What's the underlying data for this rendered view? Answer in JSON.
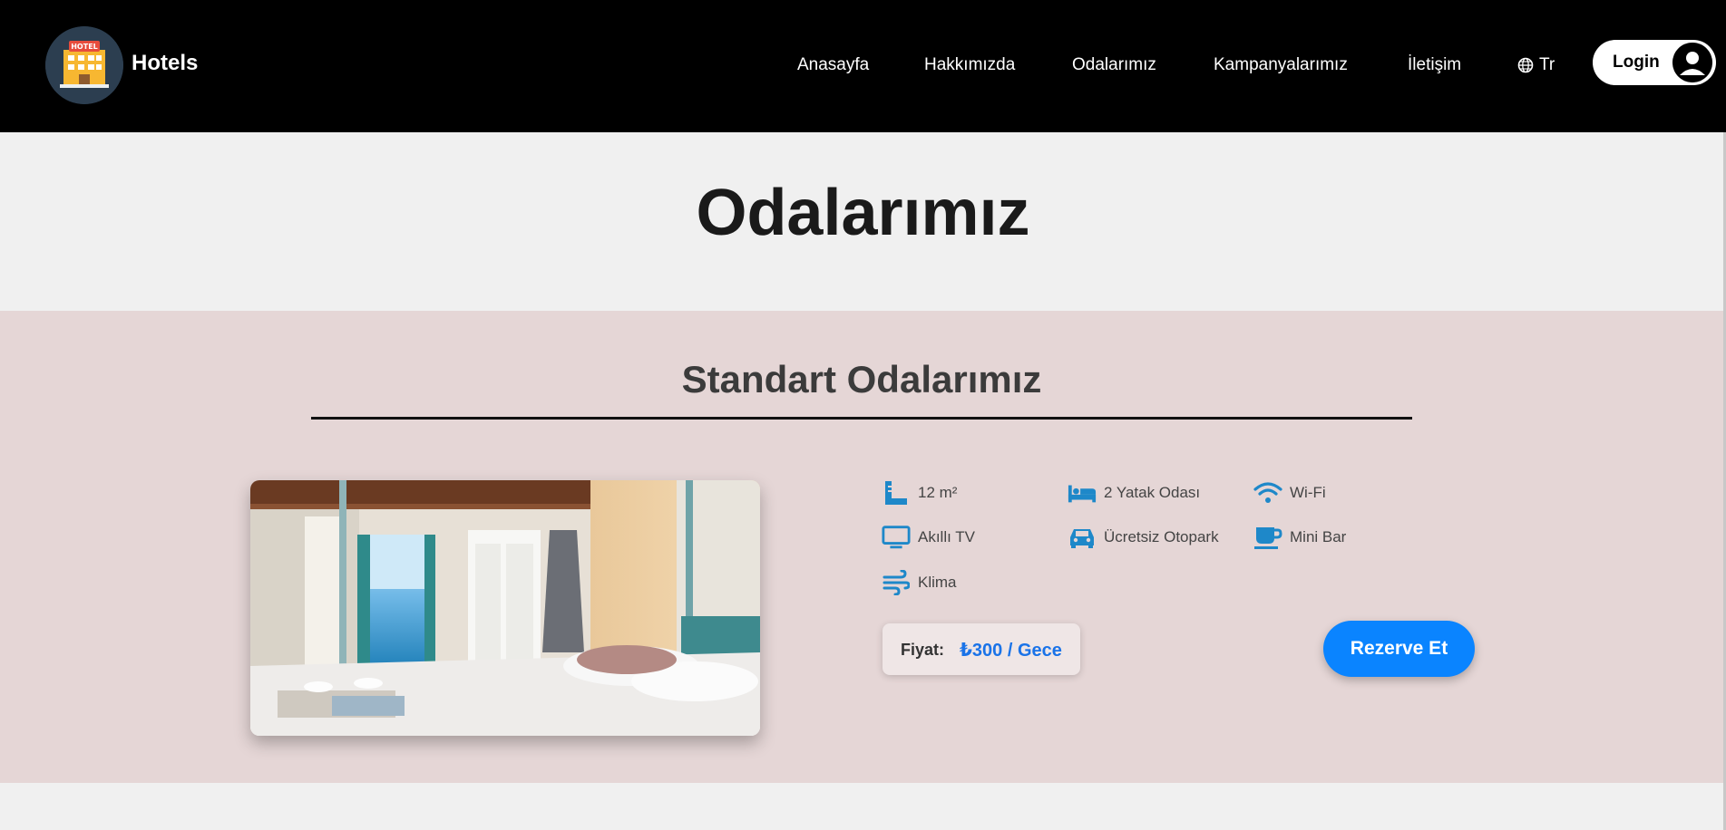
{
  "header": {
    "brand": "Hotels",
    "logo_text": "HOTEL",
    "logo_icon": "hotel-building-icon",
    "nav": [
      {
        "label": "Anasayfa"
      },
      {
        "label": "Hakkımızda"
      },
      {
        "label": "Odalarımız"
      },
      {
        "label": "Kampanyalarımız"
      },
      {
        "label": "İletişim"
      }
    ],
    "language": {
      "label": "Tr",
      "icon": "globe-icon"
    },
    "login": {
      "label": "Login",
      "icon": "user-avatar-icon"
    }
  },
  "page": {
    "title": "Odalarımız"
  },
  "section": {
    "title": "Standart Odalarımız",
    "amenities": [
      {
        "icon": "ruler-icon",
        "label": "12 m²"
      },
      {
        "icon": "bed-icon",
        "label": "2 Yatak Odası"
      },
      {
        "icon": "wifi-icon",
        "label": "Wi-Fi"
      },
      {
        "icon": "tv-icon",
        "label": "Akıllı TV"
      },
      {
        "icon": "car-icon",
        "label": "Ücretsiz Otopark"
      },
      {
        "icon": "cup-icon",
        "label": "Mini Bar"
      },
      {
        "icon": "wind-icon",
        "label": "Klima"
      }
    ],
    "price_label": "Fiyat:",
    "price_value": "₺300 / Gece",
    "reserve_label": "Rezerve Et"
  },
  "colors": {
    "header_bg": "#000000",
    "section_bg": "#e5d6d6",
    "accent_blue": "#0a84ff",
    "price_blue": "#1a73e8",
    "icon_blue": "#1e88c9"
  }
}
